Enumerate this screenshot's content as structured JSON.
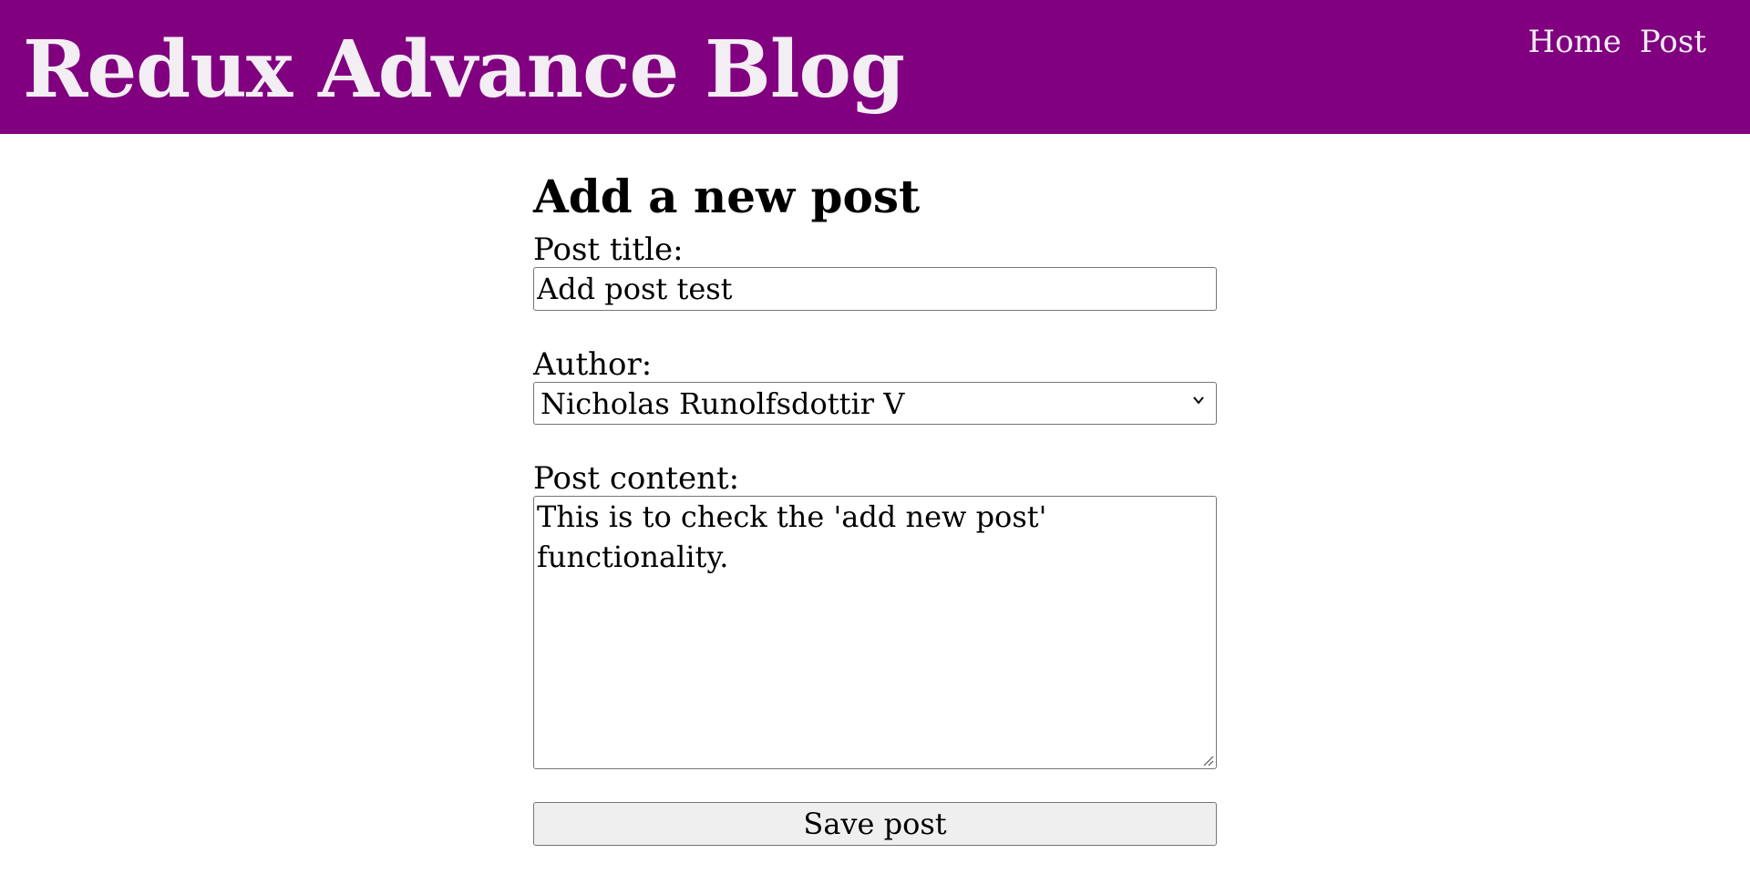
{
  "header": {
    "site_title": "Redux Advance Blog",
    "background_color": "#800080",
    "nav": [
      {
        "label": "Home"
      },
      {
        "label": "Post"
      }
    ]
  },
  "form": {
    "heading": "Add a new post",
    "title_label": "Post title:",
    "title_value": "Add post test",
    "author_label": "Author:",
    "author_selected": "Nicholas Runolfsdottir V",
    "content_label": "Post content:",
    "content_value": "This is to check the 'add new post' functionality.",
    "save_label": "Save post"
  }
}
